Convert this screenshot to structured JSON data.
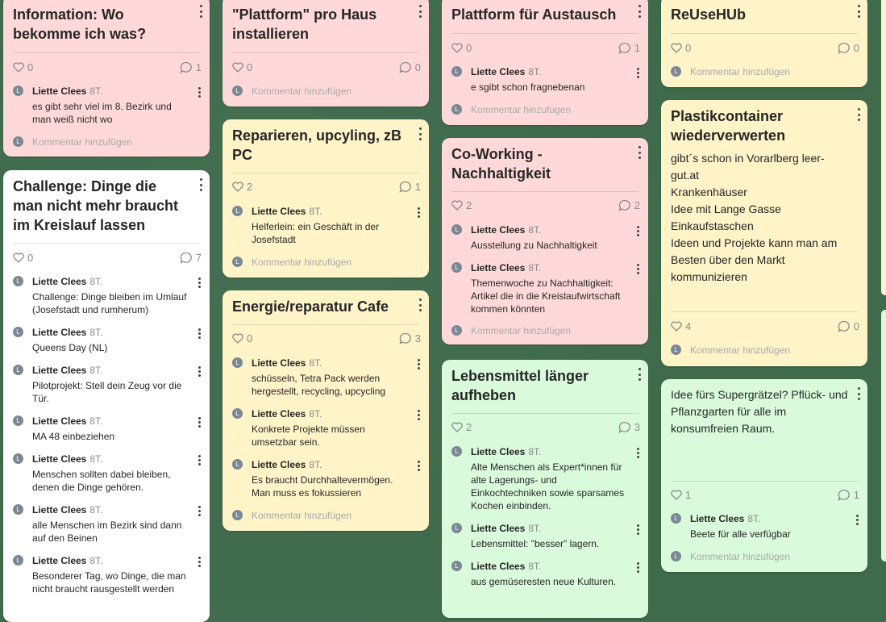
{
  "colors": {
    "background": "#3f6a4c",
    "pink": "#ffd9d9",
    "yellow": "#fff3c8",
    "green": "#d9fbdc",
    "white": "#ffffff"
  },
  "add_comment_placeholder": "Kommentar hinzufügen",
  "avatar_letter": "L",
  "author": "Liette Clees",
  "age": "8T.",
  "cards": {
    "c1": {
      "title": "Information: Wo bekomme ich was?",
      "likes": "0",
      "comments": "1",
      "items": [
        "es gibt sehr viel im 8. Bezirk und man weiß nicht wo"
      ]
    },
    "c2": {
      "title": "Challenge: Dinge die man nicht mehr braucht im Kreislauf lassen",
      "likes": "0",
      "comments": "7",
      "items": [
        "Challenge: Dinge bleiben im Umlauf (Josefstadt und rumherum)",
        "Queens Day (NL)",
        "Pilotprojekt: Stell dein Zeug vor die Tür.",
        "MA 48 einbeziehen",
        "Menschen sollten dabei bleiben, denen die Dinge gehören.",
        "alle Menschen im Bezirk sind dann auf den Beinen",
        "Besonderer Tag, wo Dinge, die man nicht braucht rausgestellt werden"
      ]
    },
    "c3": {
      "title": "\"Plattform\" pro Haus installieren",
      "likes": "0",
      "comments": "0",
      "items": []
    },
    "c4": {
      "title": "Reparieren, upcyling, zB PC",
      "likes": "2",
      "comments": "1",
      "items": [
        "Helferlein: ein Geschäft in der Josefstadt"
      ]
    },
    "c5": {
      "title": "Energie/reparatur Cafe",
      "likes": "0",
      "comments": "3",
      "items": [
        "schüsseln, Tetra Pack werden hergestellt, recycling, upcycling",
        "Konkrete Projekte müssen umsetzbar sein.",
        "Es braucht Durchhaltevermögen. Man muss es fokussieren"
      ]
    },
    "c6": {
      "title": "Plattform für Austausch",
      "likes": "0",
      "comments": "1",
      "items": [
        "e sgibt schon fragnebenan"
      ]
    },
    "c7": {
      "title": "Co-Working - Nachhaltigkeit",
      "likes": "2",
      "comments": "2",
      "items": [
        "Ausstellung zu Nachhaltigkeit",
        "Themenwoche zu Nachhaltigkeit: Artikel die in die Kreislaufwirtschaft kommen könnten"
      ]
    },
    "c8": {
      "title": "Lebensmittel länger aufheben",
      "likes": "2",
      "comments": "3",
      "items": [
        "Alte Menschen als Expert*innen für alte Lagerungs- und Einkochtechniken sowie sparsames Kochen einbinden.",
        "Lebensmittel: \"besser\" lagern.",
        "aus gemüseresten neue Kulturen."
      ]
    },
    "c9": {
      "title": "ReUseHUb",
      "likes": "0",
      "comments": "0",
      "items": []
    },
    "c10": {
      "title": "Plastikcontainer wiederverwerten",
      "body": "gibt´s schon in Vorarlberg leer-gut.at\nKrankenhäuser\nIdee mit Lange Gasse Einkaufstaschen\nIdeen und Projekte kann man am Besten über den Markt kommunizieren",
      "likes": "4",
      "comments": "0",
      "items": []
    },
    "c11": {
      "body": "Idee fürs Supergrätzel? Pflück- und Pflanzgarten für alle im konsumfreien Raum.",
      "likes": "1",
      "comments": "1",
      "items": [
        "Beete für alle verfügbar"
      ]
    }
  }
}
